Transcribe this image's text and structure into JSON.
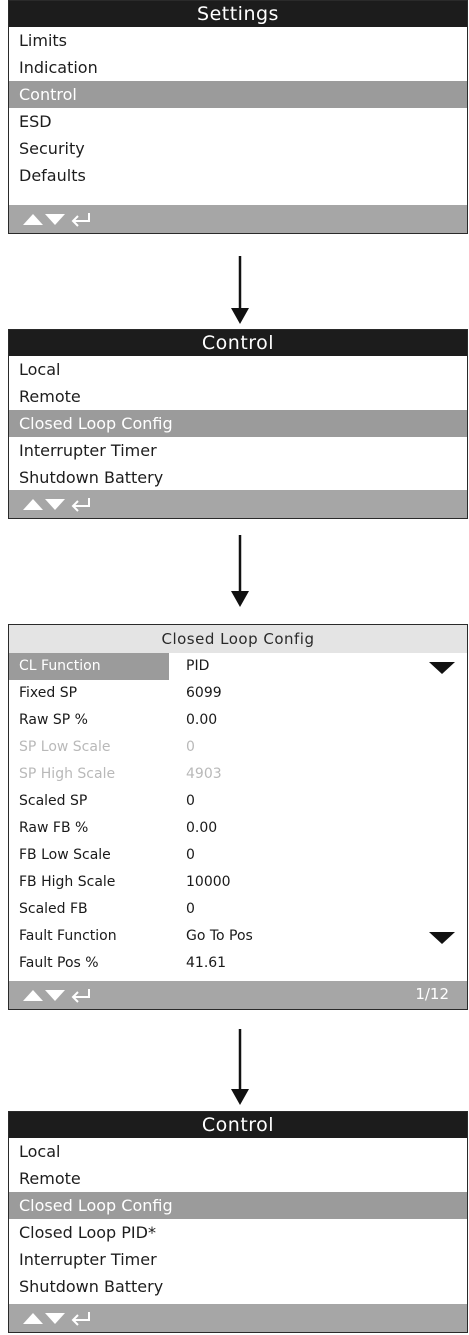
{
  "panel1": {
    "title": "Settings",
    "items": [
      "Limits",
      "Indication",
      "Control",
      "ESD",
      "Security",
      "Defaults"
    ],
    "selected": 2
  },
  "panel2": {
    "title": "Control",
    "items": [
      "Local",
      "Remote",
      "Closed Loop Config",
      "Interrupter Timer",
      "Shutdown Battery"
    ],
    "selected": 2
  },
  "panel3": {
    "title": "Closed Loop Config",
    "rows": [
      {
        "label": "CL Function",
        "value": "PID"
      },
      {
        "label": "Fixed SP",
        "value": "6099"
      },
      {
        "label": "Raw SP %",
        "value": "0.00"
      },
      {
        "label": "SP Low Scale",
        "value": "0"
      },
      {
        "label": "SP High Scale",
        "value": "4903"
      },
      {
        "label": "Scaled SP",
        "value": "0"
      },
      {
        "label": "Raw FB %",
        "value": "0.00"
      },
      {
        "label": "FB Low Scale",
        "value": "0"
      },
      {
        "label": "FB High Scale",
        "value": "10000"
      },
      {
        "label": "Scaled FB",
        "value": "0"
      },
      {
        "label": "Fault Function",
        "value": "Go To Pos"
      },
      {
        "label": "Fault Pos %",
        "value": "41.61"
      }
    ],
    "page": "1/12"
  },
  "panel4": {
    "title": "Control",
    "items": [
      "Local",
      "Remote",
      "Closed Loop Config",
      "Closed Loop PID*",
      "Interrupter Timer",
      "Shutdown Battery"
    ],
    "selected": 2
  },
  "icons": {
    "nav": "up-down-enter-icon",
    "flow": "arrow-down-icon",
    "dropdown": "dropdown-triangle-icon"
  },
  "colors": {
    "title_bar": "#1c1c1c",
    "selection": "#9b9b9b",
    "footer": "#a6a6a6"
  }
}
